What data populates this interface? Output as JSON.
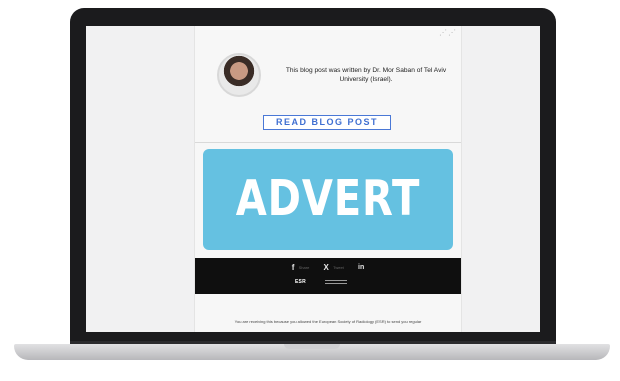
{
  "email": {
    "author_note": "This blog post was written by Dr. Mor Saban of Tel Aviv University (Israel).",
    "read_button_label": "READ BLOG POST",
    "advert_text": "ADVERT",
    "social": {
      "facebook_icon": "f",
      "facebook_label": "Share",
      "x_icon": "X",
      "x_label": "Tweet",
      "linkedin_icon": "in"
    },
    "footer_logo_text": "ESR",
    "disclaimer": "You are receiving this because you allowed the European Society of Radiology (ESR) to send you regular"
  },
  "colors": {
    "advert_bg": "#65c1e1",
    "button_accent": "#3f6fd1",
    "footer_bg": "#0f0f0f"
  }
}
